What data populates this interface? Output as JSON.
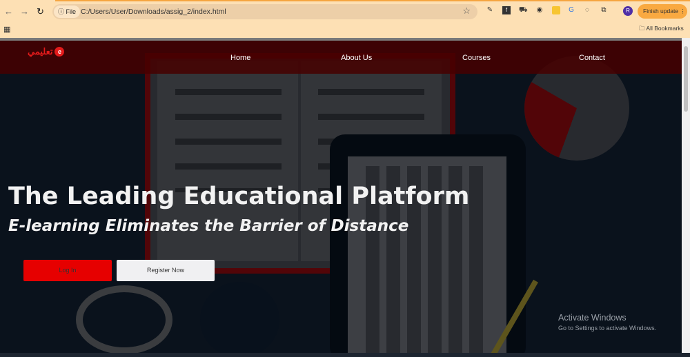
{
  "browser": {
    "chip": "File",
    "url": "C:/Users/User/Downloads/assig_2/index.html",
    "profile": "R",
    "update_label": "Finish update",
    "bookmarks_label": "All Bookmarks"
  },
  "site": {
    "logo_text": "تعليمي",
    "logo_icon": "e"
  },
  "nav": {
    "items": [
      {
        "label": "Home"
      },
      {
        "label": "About Us"
      },
      {
        "label": "Courses"
      },
      {
        "label": "Contact"
      }
    ]
  },
  "hero": {
    "title": "The Leading Educational Platform",
    "subtitle": "E-learning Eliminates the Barrier of Distance",
    "login_label": "Log In",
    "register_label": "Register Now"
  },
  "watermark": {
    "title": "Activate Windows",
    "subtitle": "Go to Settings to activate Windows."
  },
  "colors": {
    "accent": "#e60000",
    "nav_bg": "#460000",
    "hero_bg": "#0b1420"
  }
}
